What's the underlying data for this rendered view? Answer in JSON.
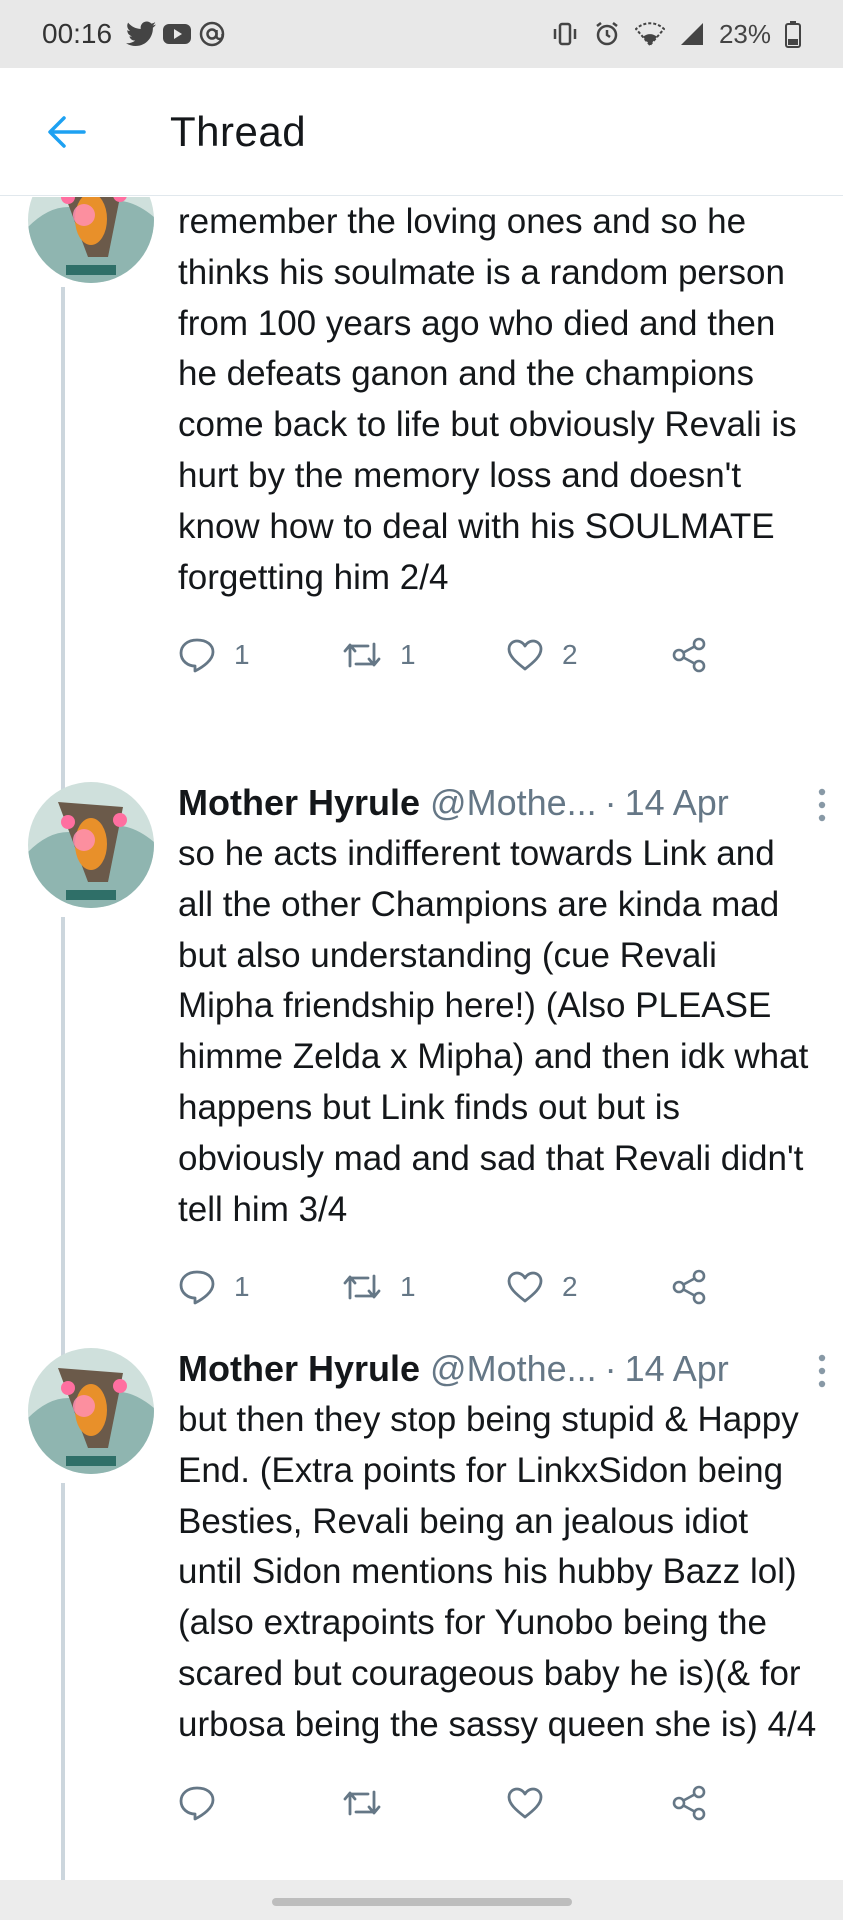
{
  "status_bar": {
    "time": "00:16",
    "battery": "23%",
    "left_icons": [
      "twitter-bird-icon",
      "youtube-icon",
      "at-icon"
    ],
    "right_icons": [
      "vibrate-icon",
      "alarm-icon",
      "wifi-icon",
      "signal-icon",
      "battery-icon"
    ]
  },
  "header": {
    "title": "Thread",
    "back_icon": "back-arrow-icon",
    "accent": "#1da1f2"
  },
  "tweets": [
    {
      "author": "",
      "handle": "",
      "date": "",
      "text": "remember the loving ones and so he thinks his soulmate is a random person from 100 years ago who died and then he defeats ganon and the champions come back to life but obviously Revali is hurt by the memory loss and doesn't know how to deal with his SOULMATE forgetting him 2/4",
      "replies": "1",
      "retweets": "1",
      "likes": "2"
    },
    {
      "author": "Mother Hyrule",
      "handle": "@Mothe...",
      "date": "14 Apr",
      "text": "so he acts indifferent towards Link and all the other Champions are kinda mad but also understanding (cue Revali Mipha friendship here!) (Also PLEASE himme Zelda x Mipha) and then idk what happens but Link finds out but is obviously mad and sad that Revali didn't tell him 3/4",
      "replies": "1",
      "retweets": "1",
      "likes": "2"
    },
    {
      "author": "Mother Hyrule",
      "handle": "@Mothe...",
      "date": "14 Apr",
      "text": "but then they stop being stupid & Happy End. (Extra points for LinkxSidon being Besties, Revali being an jealous idiot until Sidon mentions his hubby Bazz lol) (also extrapoints for Yunobo being the scared but courageous baby he is)(& for urbosa being the sassy queen she is) 4/4",
      "replies": "",
      "retweets": "",
      "likes": ""
    }
  ],
  "colors": {
    "text": "#14171a",
    "secondary": "#657786",
    "thread_line": "#ccd6dd",
    "status_bar_bg": "#e8e8e8"
  }
}
